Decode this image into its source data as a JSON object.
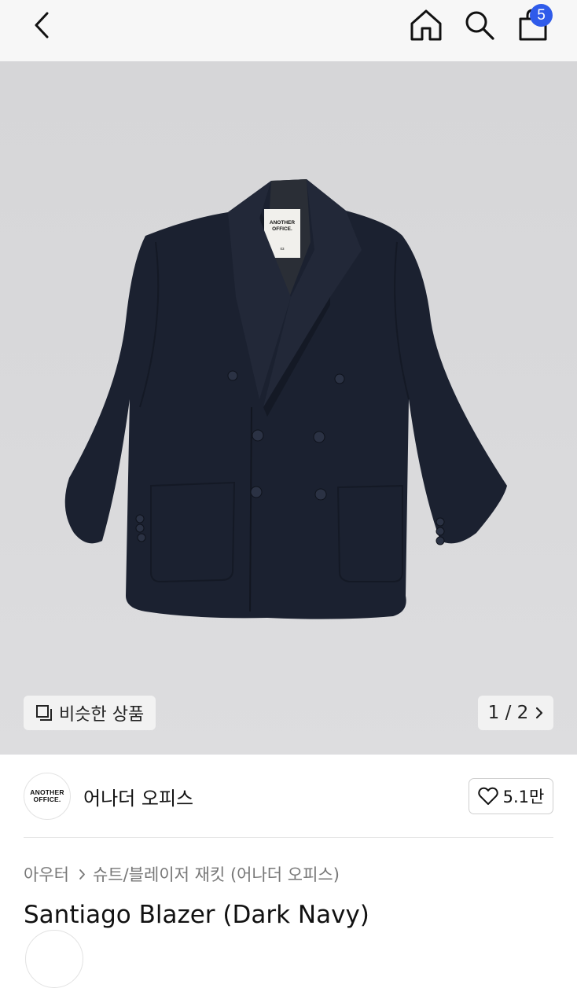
{
  "header": {
    "back_icon": "chevron-left-icon",
    "home_icon": "home-icon",
    "search_icon": "search-icon",
    "cart_icon": "shopping-bag-icon",
    "cart_count": "5"
  },
  "product_image": {
    "tag_line1": "ANOTHER",
    "tag_line2": "OFFICE.",
    "tag_line3": "03",
    "similar_button_label": "비슷한 상품",
    "similar_icon": "similar-items-icon",
    "pager_text": "1 / 2",
    "pager_icon": "chevron-right-icon"
  },
  "brand": {
    "logo_line1": "ANOTHER",
    "logo_line2": "OFFICE.",
    "name": "어나더 오피스",
    "like_icon": "heart-icon",
    "like_count": "5.1만"
  },
  "breadcrumb": {
    "category": "아우터",
    "separator_icon": "chevron-right-icon",
    "subcategory": "슈트/블레이저 재킷 (어나더 오피스)"
  },
  "product": {
    "title": "Santiago Blazer (Dark Navy)"
  },
  "colors": {
    "accent_badge": "#2f5bea",
    "jacket": "#1b2130",
    "background": "#d8d8da"
  }
}
